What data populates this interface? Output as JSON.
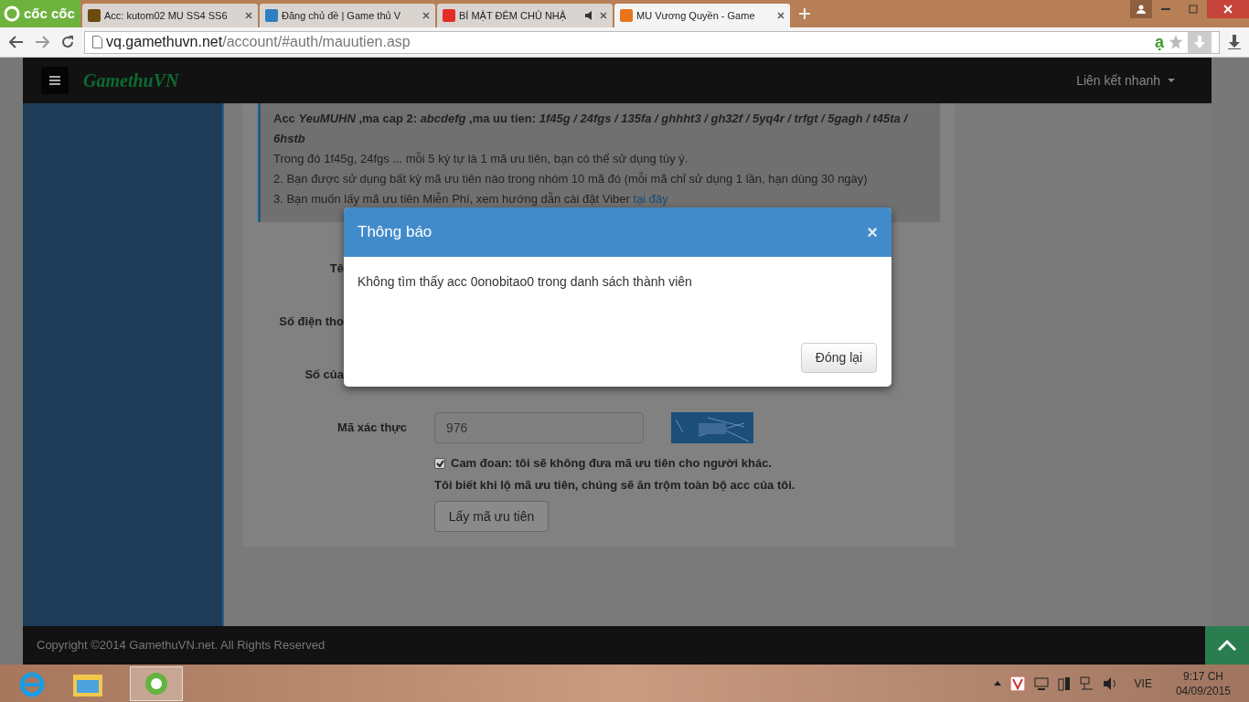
{
  "browser": {
    "logo": "cốc cốc",
    "tabs": [
      {
        "title": "Acc: kutom02 MU SS4 SS6",
        "selected": false,
        "audio": false
      },
      {
        "title": "Đăng chủ đề | Game thủ V",
        "selected": false,
        "audio": false
      },
      {
        "title": "BÍ MẬT ĐÊM CHỦ NHẬ",
        "selected": false,
        "audio": true
      },
      {
        "title": "MU Vương Quyền - Game",
        "selected": true,
        "audio": false
      }
    ],
    "url_host": "vq.gamethuvn.net",
    "url_path": "/account/#auth/mauutien.asp",
    "translate_mark": "ạ"
  },
  "navbar": {
    "logo": "GamethuVN",
    "quick_links": "Liên kết nhanh"
  },
  "notice": {
    "lines": [
      {
        "kind": "bold",
        "text": "Acc *YeuMUHN* ,ma cap 2: *abcdefg* ,ma uu tien: *1f45g / 24fgs / 135fa / ghhht3 / gh32f / 5yq4r / trfgt / 5gagh / t45ta / 6hstb*"
      },
      {
        "kind": "plain",
        "text": "Trong đó 1f45g, 24fgs ... mỗi 5 ký tự là 1 mã ưu tiên, bạn có thể sử dụng tùy ý."
      },
      {
        "kind": "plain",
        "text": "2. Bạn được sử dụng bất kỳ mã ưu tiên nào trong nhóm 10 mã đó (mỗi mã chỉ sử dụng 1 lần, hạn dùng 30 ngày)"
      },
      {
        "kind": "link",
        "text": "3. Bạn muốn lấy mã ưu tiên Miễn Phí, xem hướng dẫn cài đặt Viber",
        "link": "tại đây"
      }
    ]
  },
  "form": {
    "rows": [
      {
        "kind": "label_only",
        "label": "Tê"
      },
      {
        "kind": "label_only",
        "label": "Số điện tho"
      },
      {
        "kind": "label_only",
        "label": "Số của"
      },
      {
        "kind": "captcha",
        "label": "Mã xác thực",
        "value": "976"
      }
    ],
    "pledge": {
      "checked": true,
      "text": "Cam đoan: tôi sẽ không đưa mã ưu tiên cho người khác.",
      "text2": "Tôi biết khi lộ mã ưu tiên, chúng sẽ ăn trộm toàn bộ acc của tôi."
    },
    "submit": "Lấy mã ưu tiên"
  },
  "dialog": {
    "title": "Thông báo",
    "close": "×",
    "message": "Không tìm thấy acc 0onobitao0 trong danh sách thành viên",
    "button": "Đóng lại"
  },
  "footer": {
    "copyright": "Copyright ©2014 GamethuVN.net. All Rights Reserved"
  },
  "taskbar": {
    "language": "VIE",
    "time": "9:17 CH",
    "date": "04/09/2015"
  }
}
